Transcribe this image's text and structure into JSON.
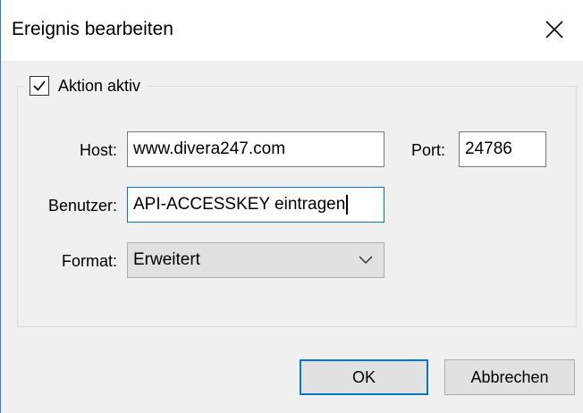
{
  "window": {
    "title": "Ereignis bearbeiten",
    "close_icon": "close-icon"
  },
  "group": {
    "checkbox_label": "Aktion aktiv",
    "checkbox_checked": true
  },
  "fields": {
    "host_label": "Host:",
    "host_value": "www.divera247.com",
    "port_label": "Port:",
    "port_value": "24786",
    "user_label": "Benutzer:",
    "user_value": "API-ACCESSKEY eintragen",
    "format_label": "Format:",
    "format_value": "Erweitert"
  },
  "buttons": {
    "ok_label": "OK",
    "cancel_label": "Abbrechen"
  },
  "colors": {
    "accent": "#0078d7",
    "window_border": "#2f7ad9",
    "background": "#f0f0f0"
  }
}
